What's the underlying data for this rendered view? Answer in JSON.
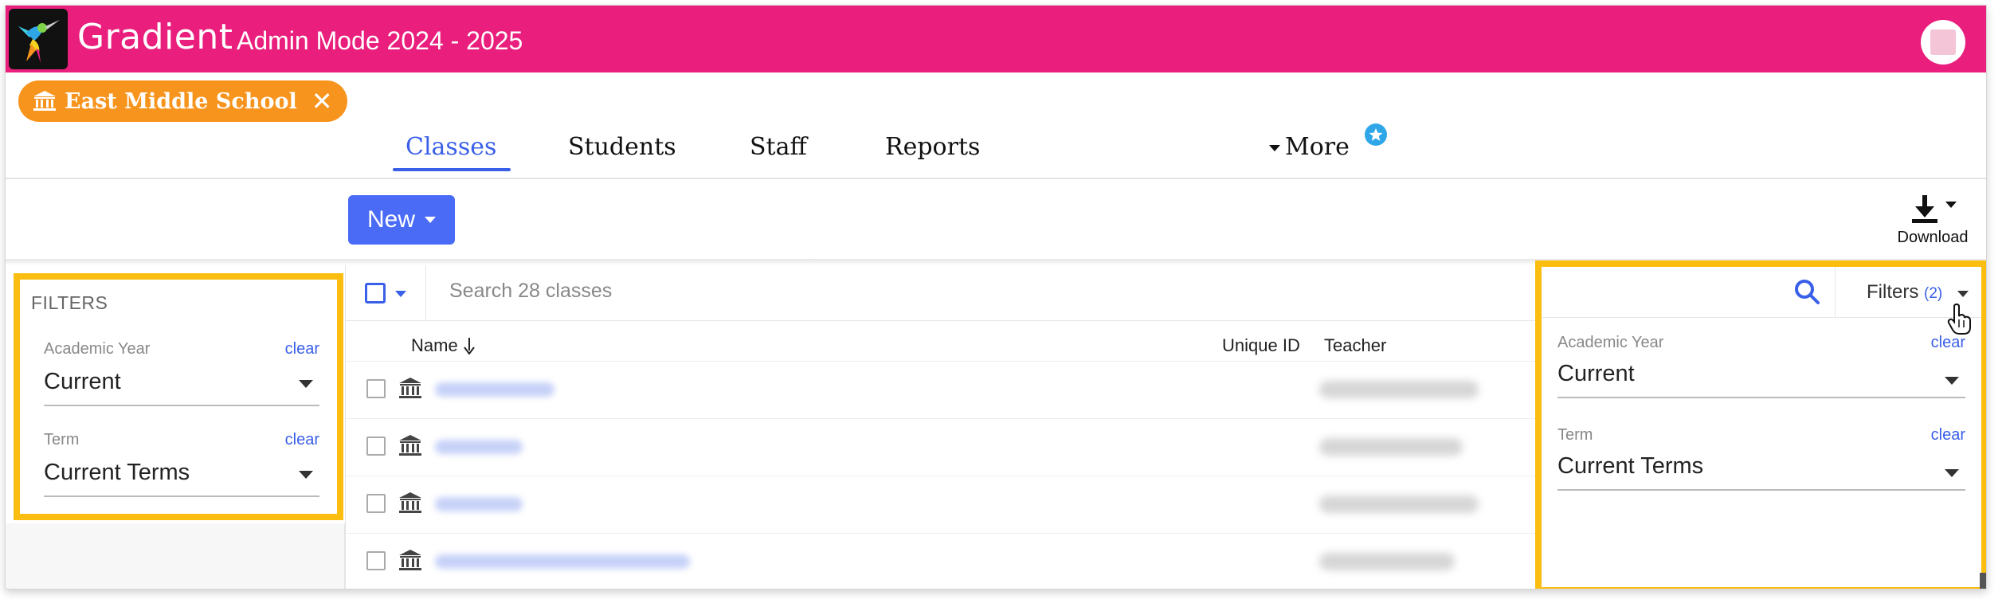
{
  "header": {
    "brand": "Gradient",
    "mode": "Admin Mode 2024 - 2025",
    "accent_color": "#e91e7d"
  },
  "school_chip": {
    "label": "East Middle School",
    "icon": "building-icon",
    "close_icon": "close-icon",
    "color": "#f7941d"
  },
  "nav": {
    "tabs": [
      {
        "label": "Classes",
        "active": true
      },
      {
        "label": "Students",
        "active": false
      },
      {
        "label": "Staff",
        "active": false
      },
      {
        "label": "Reports",
        "active": false
      },
      {
        "label": "More",
        "active": false
      }
    ],
    "active_color": "#3a5fe8"
  },
  "toolbar": {
    "new_label": "New",
    "download_label": "Download"
  },
  "left_filters": {
    "title": "FILTERS",
    "academic_year": {
      "label": "Academic Year",
      "clear": "clear",
      "value": "Current"
    },
    "term": {
      "label": "Term",
      "clear": "clear",
      "value": "Current Terms"
    }
  },
  "table": {
    "search_placeholder": "Search 28 classes",
    "columns": {
      "name": "Name",
      "unique_id": "Unique ID",
      "teacher": "Teacher"
    },
    "row_icon": "building-icon"
  },
  "right_filters": {
    "filters_label": "Filters",
    "count": "(2)",
    "academic_year": {
      "label": "Academic Year",
      "clear": "clear",
      "value": "Current"
    },
    "term": {
      "label": "Term",
      "clear": "clear",
      "value": "Current Terms"
    }
  },
  "highlight_color": "#fbbd0f"
}
